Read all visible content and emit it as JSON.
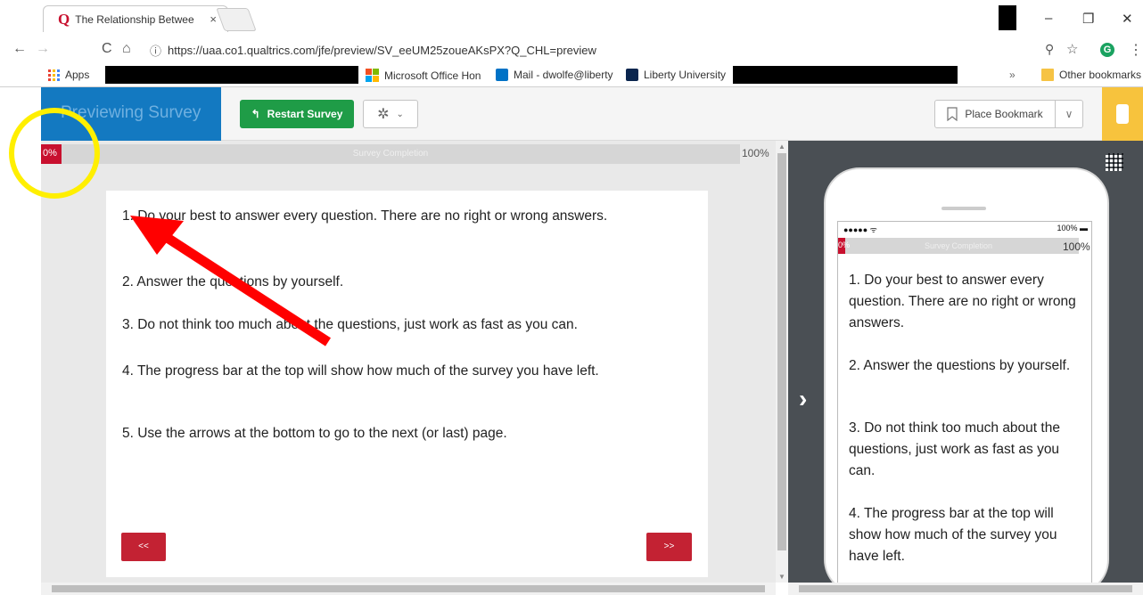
{
  "browser": {
    "tab_title": "The Relationship Betwee",
    "tab_close": "×",
    "url": "https://uaa.co1.qualtrics.com/jfe/preview/SV_eeUM25zoueAKsPX?Q_CHL=preview",
    "nav": {
      "back": "←",
      "forward": "→",
      "reload": "C",
      "home": "⌂",
      "info": "ⓘ",
      "zoom": "⚲",
      "star": "☆",
      "menu": "⋮",
      "ext": "G"
    },
    "window": {
      "minimize": "–",
      "restore": "❐",
      "close": "✕"
    },
    "bookmarks": {
      "apps": "Apps",
      "office": "Microsoft Office Hon",
      "mail": "Mail - dwolfe@liberty",
      "liberty": "Liberty University",
      "overflow": "»",
      "other": "Other bookmarks"
    }
  },
  "header": {
    "brand": "Previewing Survey",
    "restart": "Restart Survey",
    "bookmark": "Place Bookmark"
  },
  "progress": {
    "start_label": "0%",
    "label": "Survey Completion",
    "end_label": "100%",
    "value_percent": 0
  },
  "instructions": [
    "1. Do your best to answer every question. There are no right or wrong answers.",
    "2. Answer the questions by yourself.",
    "3. Do not think too much about the questions, just work as fast as you can.",
    "4. The progress bar at the top will show how much of the survey you have left.",
    "5. Use the arrows at the bottom to go to the next (or last) page."
  ],
  "navigation": {
    "prev": "<<",
    "next": ">>"
  },
  "mobile": {
    "signal": "●●●●● ᯤ",
    "battery": "100% ▬",
    "progress_start": "0%",
    "progress_label": "Survey Completion",
    "progress_end": "100%",
    "expand": "›"
  },
  "colors": {
    "qualtrics_blue": "#1379c1",
    "restart_green": "#1f9c47",
    "progress_red": "#c8102e",
    "nav_button_red": "#c32233",
    "mobile_toggle_yellow": "#f7c33d",
    "annotation_circle": "#ffef00",
    "annotation_arrow": "#ff0000"
  }
}
